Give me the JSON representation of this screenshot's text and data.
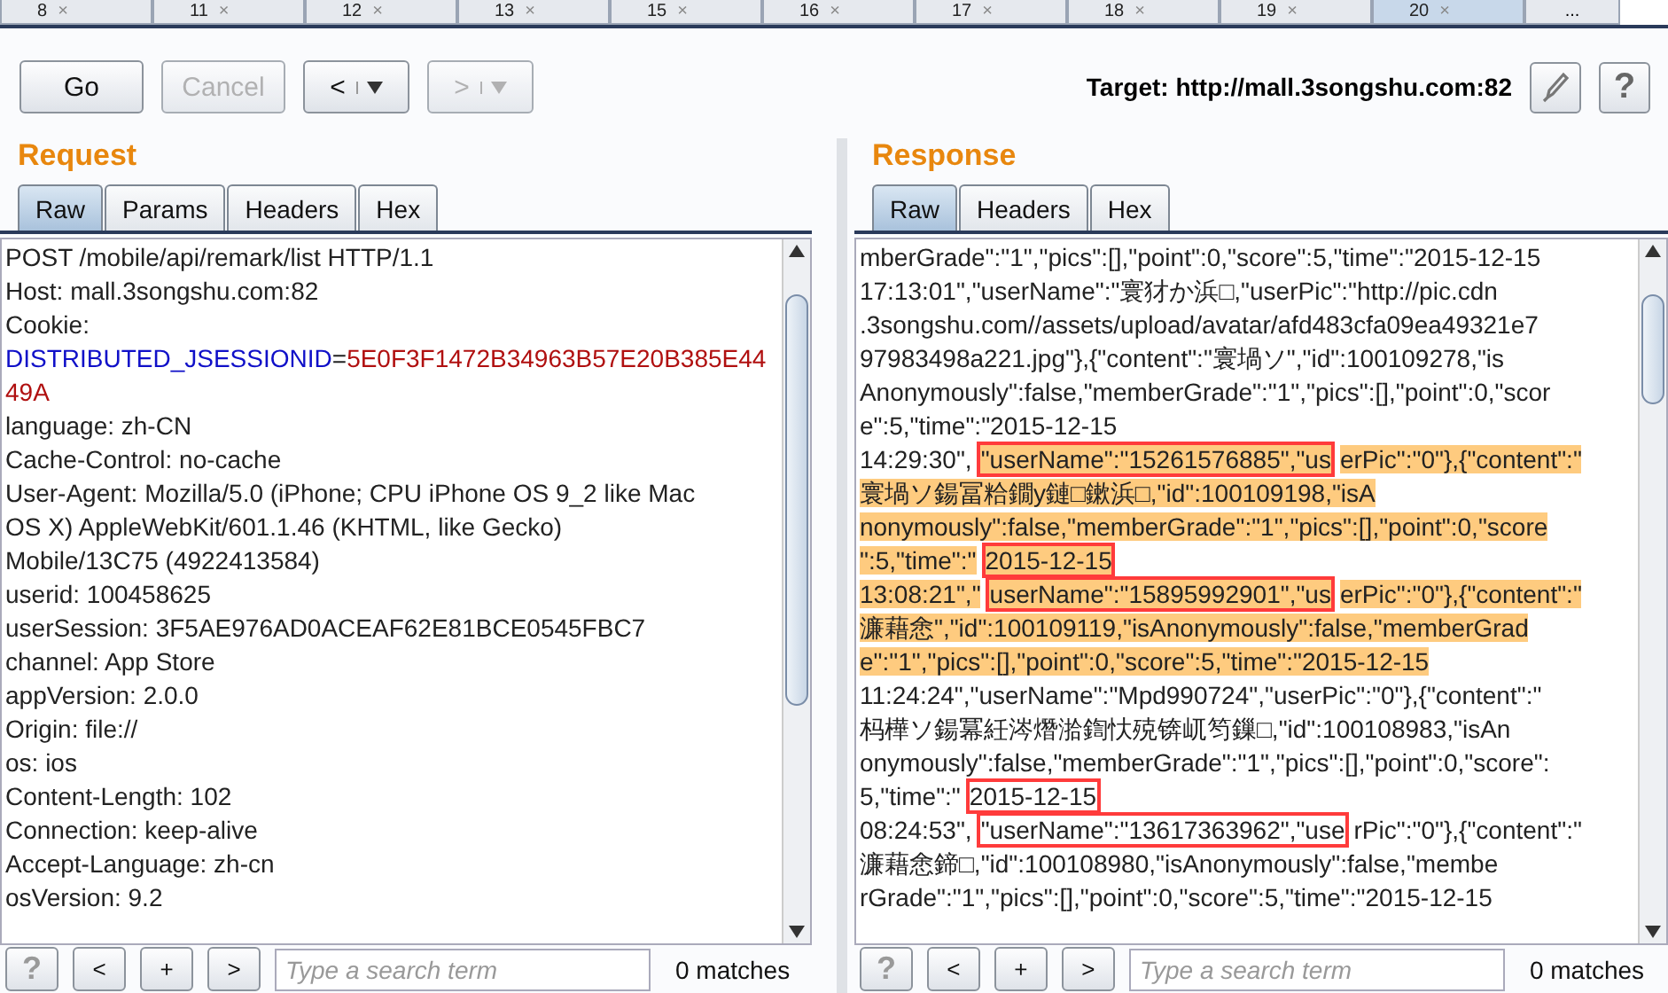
{
  "tabs": [
    {
      "label": "8",
      "selected": false
    },
    {
      "label": "11",
      "selected": false
    },
    {
      "label": "12",
      "selected": false
    },
    {
      "label": "13",
      "selected": false
    },
    {
      "label": "15",
      "selected": false
    },
    {
      "label": "16",
      "selected": false
    },
    {
      "label": "17",
      "selected": false
    },
    {
      "label": "18",
      "selected": false
    },
    {
      "label": "19",
      "selected": false
    },
    {
      "label": "20",
      "selected": true
    }
  ],
  "tab_close": "×",
  "more_tab": "...",
  "toolbar": {
    "go": {
      "label": "Go",
      "disabled": false
    },
    "cancel": {
      "label": "Cancel",
      "disabled": true
    },
    "back": {
      "label": "<",
      "disabled": false
    },
    "forward": {
      "label": ">",
      "disabled": true
    },
    "target": "Target: http://mall.3songshu.com:82",
    "help": "?"
  },
  "request": {
    "title": "Request",
    "tabs": [
      {
        "label": "Raw",
        "selected": true
      },
      {
        "label": "Params",
        "selected": false
      },
      {
        "label": "Headers",
        "selected": false
      },
      {
        "label": "Hex",
        "selected": false
      }
    ],
    "lines": [
      [
        {
          "text": "POST /mobile/api/remark/list HTTP/1.1",
          "kind": "plain"
        }
      ],
      [
        {
          "text": "Host: mall.3songshu.com:82",
          "kind": "plain"
        }
      ],
      [
        {
          "text": "Cookie:",
          "kind": "plain"
        }
      ],
      [
        {
          "text": "DISTRIBUTED_JSESSIONID",
          "kind": "key"
        },
        {
          "text": "=",
          "kind": "plain"
        },
        {
          "text": "5E0F3F1472B34963B57E20B385E44",
          "kind": "value"
        }
      ],
      [
        {
          "text": "49A",
          "kind": "value"
        }
      ],
      [
        {
          "text": "language: zh-CN",
          "kind": "plain"
        }
      ],
      [
        {
          "text": "Cache-Control: no-cache",
          "kind": "plain"
        }
      ],
      [
        {
          "text": "User-Agent: Mozilla/5.0 (iPhone; CPU iPhone OS 9_2 like Mac",
          "kind": "plain"
        }
      ],
      [
        {
          "text": "OS X) AppleWebKit/601.1.46 (KHTML, like Gecko)",
          "kind": "plain"
        }
      ],
      [
        {
          "text": "Mobile/13C75 (4922413584)",
          "kind": "plain"
        }
      ],
      [
        {
          "text": "userid: 100458625",
          "kind": "plain"
        }
      ],
      [
        {
          "text": "userSession: 3F5AE976AD0ACEAF62E81BCE0545FBC7",
          "kind": "plain"
        }
      ],
      [
        {
          "text": "channel: App Store",
          "kind": "plain"
        }
      ],
      [
        {
          "text": "appVersion: 2.0.0",
          "kind": "plain"
        }
      ],
      [
        {
          "text": "Origin: file://",
          "kind": "plain"
        }
      ],
      [
        {
          "text": "os: ios",
          "kind": "plain"
        }
      ],
      [
        {
          "text": "Content-Length: 102",
          "kind": "plain"
        }
      ],
      [
        {
          "text": "Connection: keep-alive",
          "kind": "plain"
        }
      ],
      [
        {
          "text": "Accept-Language: zh-cn",
          "kind": "plain"
        }
      ],
      [
        {
          "text": "osVersion: 9.2",
          "kind": "plain"
        }
      ]
    ],
    "search": {
      "help": "?",
      "prev": "<",
      "add": "+",
      "next": ">",
      "placeholder": "Type a search term",
      "matches": "0 matches"
    }
  },
  "response": {
    "title": "Response",
    "tabs": [
      {
        "label": "Raw",
        "selected": true
      },
      {
        "label": "Headers",
        "selected": false
      },
      {
        "label": "Hex",
        "selected": false
      }
    ],
    "lines": [
      [
        {
          "text": "mberGrade\":\"1\",\"pics\":[],\"point\":0,\"score\":5,\"time\":\"2015-12-15",
          "selected": false
        }
      ],
      [
        {
          "text": "17:13:01\",\"userName\":\"寰犲か浜□,\"userPic\":\"http://pic.cdn",
          "selected": false
        }
      ],
      [
        {
          "text": ".3songshu.com//assets/upload/avatar/afd483cfa09ea49321e7",
          "selected": false
        }
      ],
      [
        {
          "text": "97983498a221.jpg\"},{\"content\":\"寰堝ソ\",\"id\":100109278,\"is",
          "selected": false
        }
      ],
      [
        {
          "text": "Anonymously\":false,\"memberGrade\":\"1\",\"pics\":[],\"point\":0,\"scor",
          "selected": false
        }
      ],
      [
        {
          "text": "e\":5,\"time\":\"2015-12-15",
          "selected": false
        }
      ],
      [
        {
          "text": "14:29:30\",",
          "selected": false
        },
        {
          "text": "\"userName\":\"15261576885\",\"us",
          "selected": true,
          "boxed": true
        },
        {
          "text": "erPic\":\"0\"},{\"content\":\"",
          "selected": true
        }
      ],
      [
        {
          "text": "寰堝ソ鍚冨粭鐗у鏈□鏉浜□,\"id\":100109198,\"isA",
          "selected": true
        }
      ],
      [
        {
          "text": "nonymously\":false,\"memberGrade\":\"1\",\"pics\":[],\"point\":0,\"score",
          "selected": true
        }
      ],
      [
        {
          "text": "\":5,\"time\":\"",
          "selected": true
        },
        {
          "text": "2015-12-15",
          "selected": true,
          "boxed": true
        }
      ],
      [
        {
          "text": "13:08:21\",\"",
          "selected": true
        },
        {
          "text": "userName\":\"15895992901\",\"us",
          "selected": true,
          "boxed": true
        },
        {
          "text": "erPic\":\"0\"},{\"content\":\"",
          "selected": true
        }
      ],
      [
        {
          "text": "濂藉悆\",\"id\":100109119,\"isAnonymously\":false,\"memberGrad",
          "selected": true
        }
      ],
      [
        {
          "text": "e\":\"1\",\"pics\":[],\"point\":0,\"score\":5,\"time\":\"2015-12-15",
          "selected": true
        }
      ],
      [
        {
          "text": "11:24:24\",\"userName\":\"Mpd990724\",\"userPic\":\"0\"},{\"content\":\"",
          "selected": false
        }
      ],
      [
        {
          "text": "杩樺ソ鍚冪紝涔熸湁鍧忕殑锛屼笉鏁□,\"id\":100108983,\"isAn",
          "selected": false
        }
      ],
      [
        {
          "text": "onymously\":false,\"memberGrade\":\"1\",\"pics\":[],\"point\":0,\"score\":",
          "selected": false
        }
      ],
      [
        {
          "text": "5,\"time\":\"",
          "selected": false
        },
        {
          "text": "2015-12-15",
          "selected": false,
          "boxed": true
        }
      ],
      [
        {
          "text": "08:24:53\",",
          "selected": false
        },
        {
          "text": "\"userName\":\"13617363962\",\"use",
          "selected": false,
          "boxed": true
        },
        {
          "text": "rPic\":\"0\"},{\"content\":\"",
          "selected": false
        }
      ],
      [
        {
          "text": "濂藉悆鍗□,\"id\":100108980,\"isAnonymously\":false,\"membe",
          "selected": false
        }
      ],
      [
        {
          "text": "rGrade\":\"1\",\"pics\":[],\"point\":0,\"score\":5,\"time\":\"2015-12-15",
          "selected": false
        }
      ]
    ],
    "search": {
      "help": "?",
      "prev": "<",
      "add": "+",
      "next": ">",
      "placeholder": "Type a search term",
      "matches": "0 matches"
    }
  }
}
